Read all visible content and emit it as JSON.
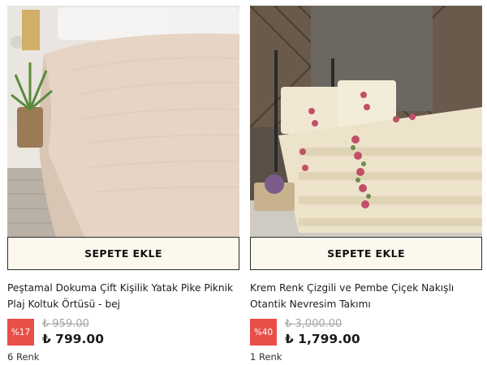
{
  "products": [
    {
      "cart_label": "SEPETE EKLE",
      "title_line1": "Peştamal Dokuma Çift Kişilik Yatak Pike Piknik",
      "title_line2": "Plaj Koltuk Örtüsü - bej",
      "discount": "%17",
      "old_price": "₺ 959.00",
      "new_price": "₺ 799.00",
      "colors": "6 Renk",
      "image": "beige-bedspread-photo"
    },
    {
      "cart_label": "SEPETE EKLE",
      "title_line1": "Krem Renk Çizgili ve Pembe Çiçek Nakışlı",
      "title_line2": "Otantik Nevresim Takımı",
      "discount": "%40",
      "old_price": "₺ 3,000.00",
      "new_price": "₺ 1,799.00",
      "colors": "1 Renk",
      "image": "floral-duvet-set-photo"
    }
  ],
  "colors": {
    "badge": "#e94f49",
    "button_bg": "#fdf8ee",
    "old_price": "#a6a6a6"
  }
}
